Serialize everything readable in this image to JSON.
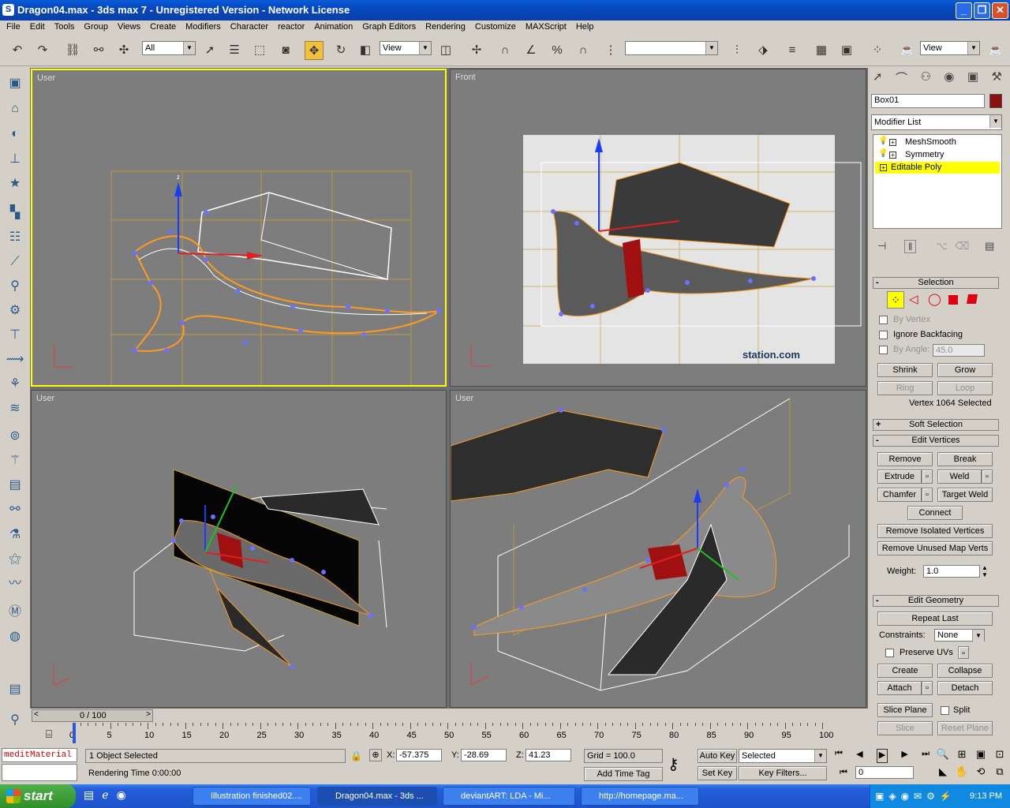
{
  "window": {
    "title": "Dragon04.max - 3ds max 7  - Unregistered Version - Network License",
    "min_label": "_",
    "max_label": "❐",
    "close_label": "✕"
  },
  "menu": [
    "File",
    "Edit",
    "Tools",
    "Group",
    "Views",
    "Create",
    "Modifiers",
    "Character",
    "reactor",
    "Animation",
    "Graph Editors",
    "Rendering",
    "Customize",
    "MAXScript",
    "Help"
  ],
  "toolbar": {
    "selection_filter": "All",
    "coord_system": "View",
    "named_selection": "",
    "render_view": "View"
  },
  "viewports": {
    "top_left": "User",
    "top_right": "Front",
    "bottom_left": "User",
    "bottom_right": "User",
    "watermark": "station.com"
  },
  "command_panel": {
    "object_name": "Box01",
    "object_color": "#8b1010",
    "modifier_list": "Modifier List",
    "stack": [
      "MeshSmooth",
      "Symmetry",
      "Editable Poly"
    ],
    "selection": {
      "header": "Selection",
      "by_vertex": "By Vertex",
      "ignore_backfacing": "Ignore Backfacing",
      "by_angle": "By Angle:",
      "angle_value": "45.0",
      "shrink": "Shrink",
      "grow": "Grow",
      "ring": "Ring",
      "loop": "Loop",
      "status": "Vertex 1064 Selected"
    },
    "soft_selection": "Soft Selection",
    "edit_vertices": {
      "header": "Edit Vertices",
      "remove": "Remove",
      "break": "Break",
      "extrude": "Extrude",
      "weld": "Weld",
      "chamfer": "Chamfer",
      "target_weld": "Target Weld",
      "connect": "Connect",
      "remove_isolated": "Remove Isolated Vertices",
      "remove_unused": "Remove Unused Map Verts",
      "weight_label": "Weight:",
      "weight_value": "1.0"
    },
    "edit_geometry": {
      "header": "Edit Geometry",
      "repeat_last": "Repeat Last",
      "constraints_label": "Constraints:",
      "constraints_value": "None",
      "preserve_uvs": "Preserve UVs",
      "create": "Create",
      "collapse": "Collapse",
      "attach": "Attach",
      "detach": "Detach",
      "slice_plane": "Slice Plane",
      "split": "Split",
      "slice": "Slice",
      "reset_plane": "Reset Plane"
    }
  },
  "timeline": {
    "frame_display": "0 / 100",
    "ticks": [
      "0",
      "5",
      "10",
      "15",
      "20",
      "25",
      "30",
      "35",
      "40",
      "45",
      "50",
      "55",
      "60",
      "65",
      "70",
      "75",
      "80",
      "85",
      "90",
      "95",
      "100"
    ]
  },
  "status": {
    "maxscript": "meditMaterial",
    "selected": "1 Object Selected",
    "rendering_time": "Rendering Time  0:00:00",
    "x_label": "X:",
    "x": "-57.375",
    "y_label": "Y:",
    "y": "-28.69",
    "z_label": "Z:",
    "z": "41.23",
    "grid": "Grid = 100.0",
    "add_time_tag": "Add Time Tag",
    "auto_key": "Auto Key",
    "set_key": "Set Key",
    "key_mode": "Selected",
    "key_filters": "Key Filters...",
    "current_frame": "0"
  },
  "taskbar": {
    "start": "start",
    "tasks": [
      "Illustration finished02....",
      "Dragon04.max - 3ds ...",
      "deviantART: LDA - Mi...",
      "http://homepage.ma..."
    ],
    "clock": "9:13 PM"
  }
}
